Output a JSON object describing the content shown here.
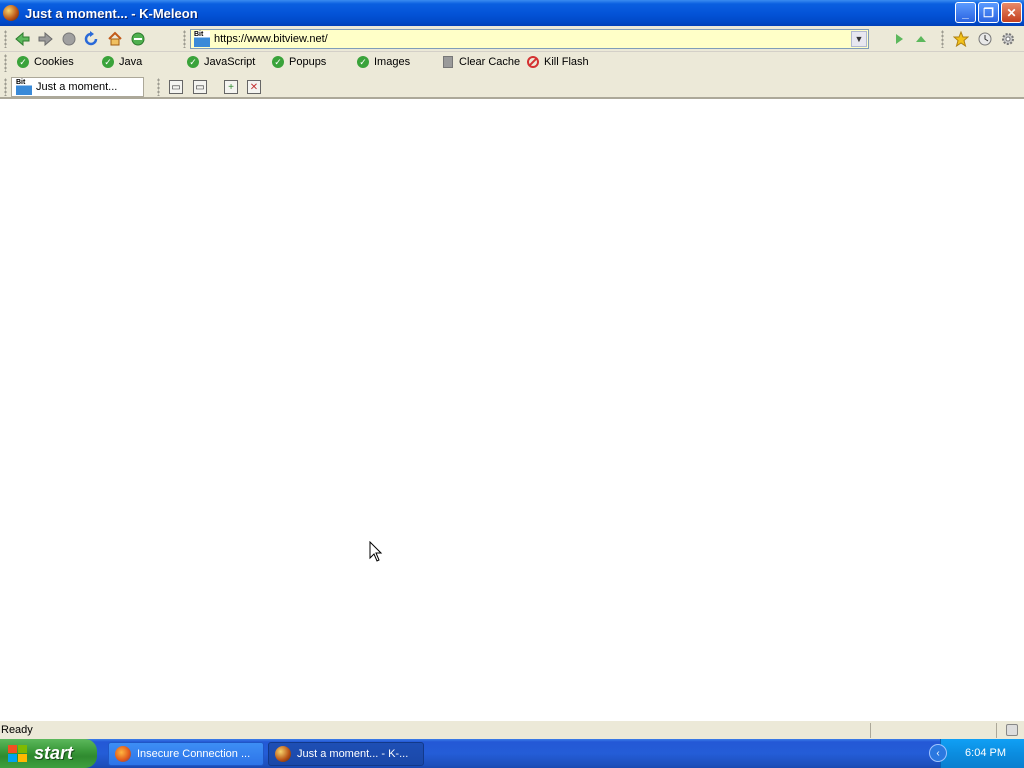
{
  "window": {
    "title": "Just a moment... - K-Meleon",
    "minimize": "_",
    "restore": "❐",
    "close": "✕"
  },
  "nav": {
    "url": "https://www.bitview.net/",
    "site_icon_text": "Bit"
  },
  "privacy_bar": {
    "cookies": "Cookies",
    "java": "Java",
    "javascript": "JavaScript",
    "popups": "Popups",
    "images": "Images",
    "clear_cache": "Clear Cache",
    "kill_flash": "Kill Flash"
  },
  "tab": {
    "label": "Just a moment..."
  },
  "status": {
    "text": "Ready"
  },
  "taskbar": {
    "start": "start",
    "tasks": [
      {
        "label": "Insecure Connection ..."
      },
      {
        "label": "Just a moment... - K-..."
      }
    ],
    "clock": "6:04 PM"
  }
}
